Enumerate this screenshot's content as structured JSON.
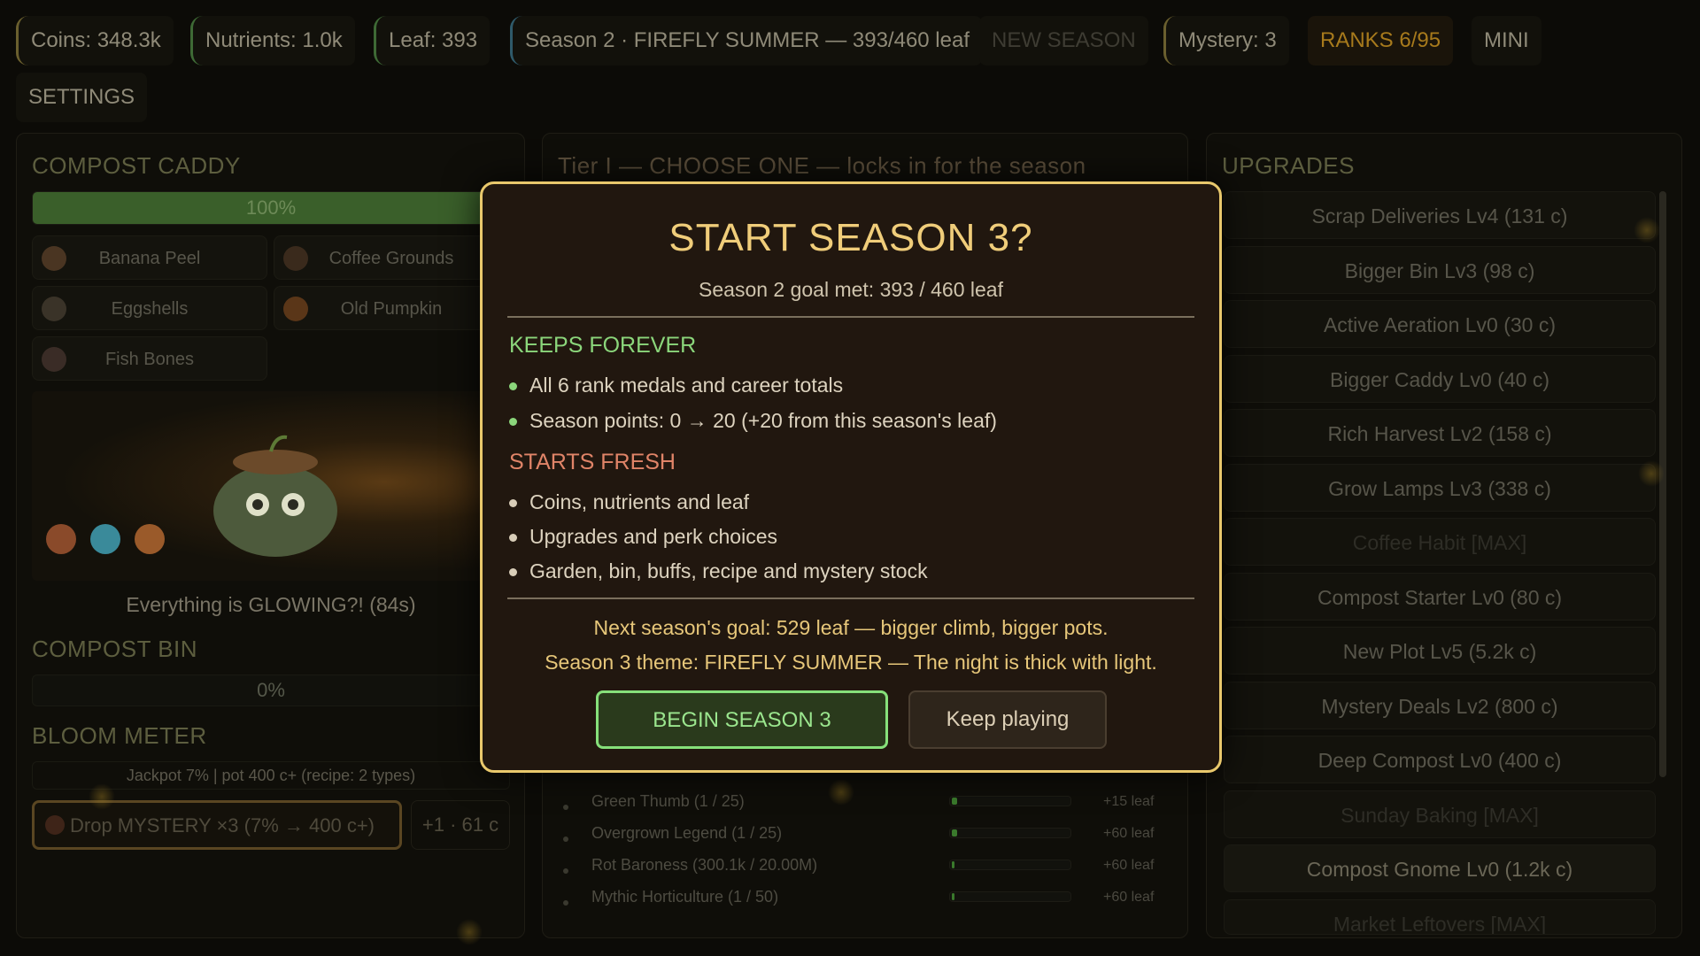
{
  "topbar": {
    "coins": "Coins: 348.3k",
    "nutrients": "Nutrients: 1.0k",
    "leaf": "Leaf: 393",
    "season": "Season 2 · FIREFLY SUMMER — 393/460 leaf",
    "new_season": "NEW SEASON",
    "mystery": "Mystery: 3",
    "ranks": "RANKS  6/95",
    "mini": "MINI",
    "settings": "SETTINGS"
  },
  "caddy": {
    "title": "COMPOST CADDY",
    "progress_label": "100%",
    "progress_value": 100,
    "items": [
      "Banana Peel",
      "Coffee Grounds",
      "Eggshells",
      "Old Pumpkin",
      "Fish Bones"
    ],
    "status": "Everything is GLOWING?! (84s)"
  },
  "bin": {
    "title": "COMPOST BIN",
    "progress_label": "0%",
    "progress_value": 0
  },
  "bloom": {
    "title": "BLOOM METER",
    "info": "Jackpot 7%  |  pot 400 c+  (recipe: 2 types)",
    "drop_button": "Drop MYSTERY ×3  (7% → 400 c+)",
    "plus_button": "+1 · 61 c"
  },
  "tier": {
    "title": "Tier I — CHOOSE ONE — locks in for the season",
    "rows": [
      {
        "name": "Green Thumb  (1 / 25)",
        "reward": "+15 leaf"
      },
      {
        "name": "Overgrown Legend  (1 / 25)",
        "reward": "+60 leaf"
      },
      {
        "name": "Rot Baroness  (300.1k / 20.00M)",
        "reward": "+60 leaf"
      },
      {
        "name": "Mythic Horticulture  (1 / 50)",
        "reward": "+60 leaf"
      }
    ]
  },
  "upgrades": {
    "title": "UPGRADES",
    "items": [
      "Scrap Deliveries  Lv4  (131 c)",
      "Bigger Bin  Lv3  (98 c)",
      "Active Aeration  Lv0  (30 c)",
      "Bigger Caddy  Lv0  (40 c)",
      "Rich Harvest  Lv2  (158 c)",
      "Grow Lamps  Lv3  (338 c)",
      "Coffee Habit [MAX]",
      "Compost Starter  Lv0  (80 c)",
      "New Plot  Lv5  (5.2k c)",
      "Mystery Deals  Lv2  (800 c)",
      "Deep Compost  Lv0  (400 c)",
      "Sunday Baking [MAX]",
      "Compost Gnome  Lv0  (1.2k c)",
      "Market Leftovers [MAX]"
    ]
  },
  "modal": {
    "title": "START SEASON 3?",
    "subtitle": "Season 2 goal met:  393 / 460 leaf",
    "keeps_title": "KEEPS FOREVER",
    "keeps": [
      "All 6 rank medals and career totals",
      "Season points:  0  →  20   (+20 from this season's leaf)"
    ],
    "fresh_title": "STARTS FRESH",
    "fresh": [
      "Coins, nutrients and leaf",
      "Upgrades and perk choices",
      "Garden, bin, buffs, recipe and mystery stock"
    ],
    "goal_note": "Next season's goal: 529 leaf — bigger climb, bigger pots.",
    "theme_note": "Season 3 theme: FIREFLY SUMMER — The night is thick with light.",
    "begin_button": "BEGIN SEASON 3",
    "keep_button": "Keep playing"
  },
  "colors": {
    "accent_gold": "#e9c86c",
    "keep_green": "#8bd67b",
    "fresh_red": "#e08468"
  }
}
